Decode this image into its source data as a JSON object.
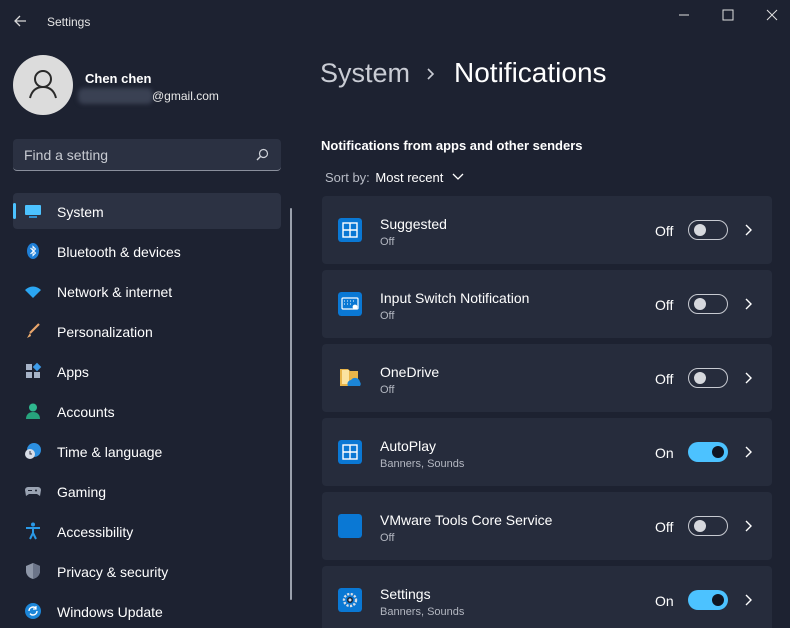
{
  "window": {
    "title": "Settings",
    "controls": {
      "minimize_icon": "minimize-icon",
      "maximize_icon": "maximize-icon",
      "close_icon": "close-icon"
    }
  },
  "user": {
    "name": "Chen chen",
    "email_visible": "@gmail.com",
    "avatar_icon": "user-avatar-icon"
  },
  "search": {
    "placeholder": "Find a setting",
    "icon": "search-icon"
  },
  "sidebar": {
    "items": [
      {
        "label": "System",
        "icon": "monitor-icon",
        "selected": true
      },
      {
        "label": "Bluetooth & devices",
        "icon": "bluetooth-icon"
      },
      {
        "label": "Network & internet",
        "icon": "wifi-icon"
      },
      {
        "label": "Personalization",
        "icon": "brush-icon"
      },
      {
        "label": "Apps",
        "icon": "apps-icon"
      },
      {
        "label": "Accounts",
        "icon": "person-icon"
      },
      {
        "label": "Time & language",
        "icon": "clock-globe-icon"
      },
      {
        "label": "Gaming",
        "icon": "gamepad-icon"
      },
      {
        "label": "Accessibility",
        "icon": "accessibility-icon"
      },
      {
        "label": "Privacy & security",
        "icon": "shield-icon"
      },
      {
        "label": "Windows Update",
        "icon": "update-icon"
      }
    ]
  },
  "breadcrumb": {
    "parent": "System",
    "current": "Notifications"
  },
  "main": {
    "section_title": "Notifications from apps and other senders",
    "sort_label": "Sort by:",
    "sort_value": "Most recent",
    "apps": [
      {
        "name": "Suggested",
        "subtitle": "Off",
        "state": "Off",
        "on": false,
        "icon": "suggested-app-icon"
      },
      {
        "name": "Input Switch Notification",
        "subtitle": "Off",
        "state": "Off",
        "on": false,
        "icon": "keyboard-app-icon"
      },
      {
        "name": "OneDrive",
        "subtitle": "Off",
        "state": "Off",
        "on": false,
        "icon": "onedrive-folder-icon"
      },
      {
        "name": "AutoPlay",
        "subtitle": "Banners, Sounds",
        "state": "On",
        "on": true,
        "icon": "autoplay-app-icon"
      },
      {
        "name": "VMware Tools Core Service",
        "subtitle": "Off",
        "state": "Off",
        "on": false,
        "icon": "vmware-app-icon"
      },
      {
        "name": "Settings",
        "subtitle": "Banners, Sounds",
        "state": "On",
        "on": true,
        "icon": "settings-gear-icon"
      }
    ]
  },
  "colors": {
    "background": "#1d2231",
    "card": "#262c3c",
    "accent": "#4cc2ff",
    "app_tile": "#0a78d4"
  }
}
